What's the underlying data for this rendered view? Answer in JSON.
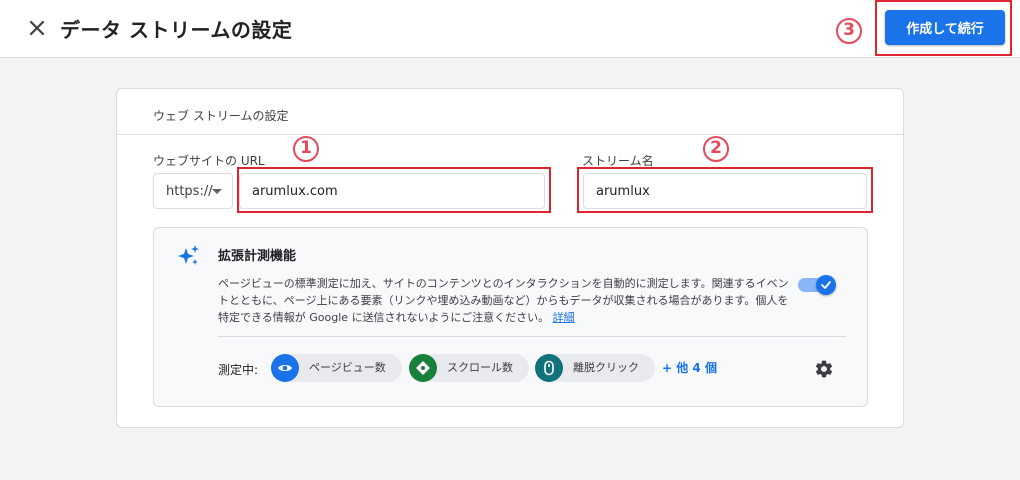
{
  "header": {
    "title": "データ ストリームの設定",
    "create_button_label": "作成して続行"
  },
  "markers": [
    "1",
    "2",
    "3"
  ],
  "card": {
    "title": "ウェブ ストリームの設定",
    "url_label": "ウェブサイトの URL",
    "protocol_value": "https://",
    "url_value": "arumlux.com",
    "stream_name_label": "ストリーム名",
    "stream_name_value": "arumlux"
  },
  "enhanced": {
    "title": "拡張計測機能",
    "description": "ページビューの標準測定に加え、サイトのコンテンツとのインタラクションを自動的に測定します。関連するイベントとともに、ページ上にある要素（リンクや埋め込み動画など）からもデータが収集される場合があります。個人を特定できる情報が Google に送信されないようにご注意ください。",
    "details_link": "詳細",
    "toggle_on": true,
    "measuring_label": "測定中:",
    "chips": [
      {
        "label": "ページビュー数",
        "color": "#1a73e8",
        "icon": "eye-icon"
      },
      {
        "label": "スクロール数",
        "color": "#188038",
        "icon": "scroll-icon"
      },
      {
        "label": "離脱クリック",
        "color": "#12727c",
        "icon": "mouse-icon"
      }
    ],
    "more_label": "+ 他 4 個"
  },
  "colors": {
    "accent": "#1a73e8",
    "annotation": "#e0242f"
  }
}
